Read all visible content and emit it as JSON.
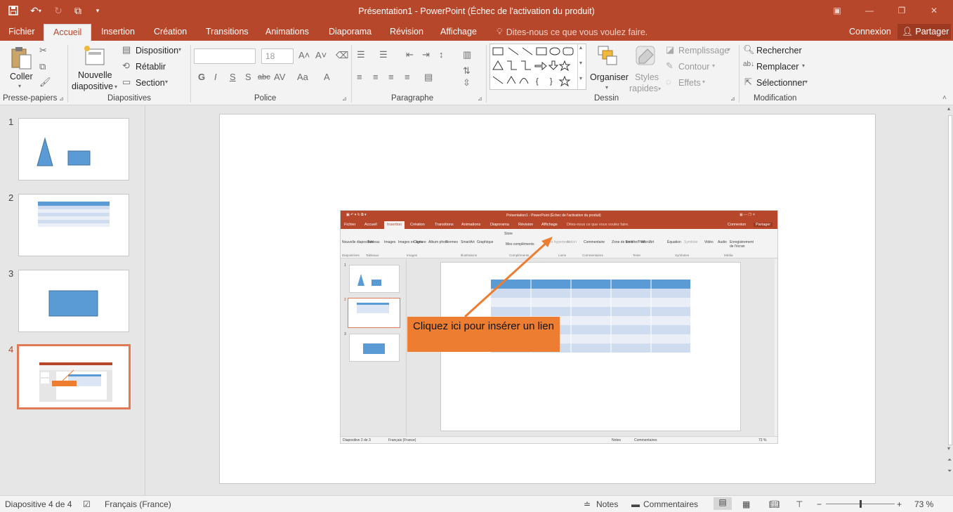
{
  "app": {
    "title": "Présentation1 - PowerPoint (Échec de l'activation du produit)",
    "accent": "#b7472a"
  },
  "quick_access": [
    "save-icon",
    "undo-icon",
    "redo-icon",
    "present-icon",
    "customize-icon"
  ],
  "tabs": [
    {
      "label": "Fichier",
      "active": false
    },
    {
      "label": "Accueil",
      "active": true
    },
    {
      "label": "Insertion",
      "active": false
    },
    {
      "label": "Création",
      "active": false
    },
    {
      "label": "Transitions",
      "active": false
    },
    {
      "label": "Animations",
      "active": false
    },
    {
      "label": "Diaporama",
      "active": false
    },
    {
      "label": "Révision",
      "active": false
    },
    {
      "label": "Affichage",
      "active": false
    }
  ],
  "tell_me": "Dites-nous ce que vous voulez faire.",
  "account": {
    "signin": "Connexion",
    "share": "Partager"
  },
  "ribbon": {
    "clipboard": {
      "paste": "Coller",
      "group": "Presse-papiers"
    },
    "slides": {
      "new_slide_1": "Nouvelle",
      "new_slide_2": "diapositive",
      "layout": "Disposition",
      "reset": "Rétablir",
      "section": "Section",
      "group": "Diapositives"
    },
    "font": {
      "name": "",
      "size": "18",
      "group": "Police"
    },
    "paragraph": {
      "group": "Paragraphe"
    },
    "drawing": {
      "arrange": "Organiser",
      "quick_styles_1": "Styles",
      "quick_styles_2": "rapides",
      "fill": "Remplissage",
      "outline": "Contour",
      "effects": "Effets",
      "group": "Dessin"
    },
    "editing": {
      "find": "Rechercher",
      "replace": "Remplacer",
      "select": "Sélectionner",
      "group": "Modification"
    }
  },
  "thumbnails": [
    {
      "number": "1",
      "selected": false
    },
    {
      "number": "2",
      "selected": false
    },
    {
      "number": "3",
      "selected": false
    },
    {
      "number": "4",
      "selected": true
    }
  ],
  "slide": {
    "callout": "Cliquez ici pour insérer un lien",
    "embedded": {
      "title": "Présentation1 - PowerPoint (Échec de l'activation du produit)",
      "tabs": [
        "Fichier",
        "Accueil",
        "Insertion",
        "Création",
        "Transitions",
        "Animations",
        "Diaporama",
        "Révision",
        "Affichage"
      ],
      "active_tab": "Insertion",
      "tell_me": "Dites-nous ce que vous voulez faire.",
      "signin": "Connexion",
      "share": "Partager",
      "ribbon_items": [
        "Nouvelle diapositive",
        "Tableau",
        "Images",
        "Images en ligne",
        "Capture",
        "Album photo",
        "Formes",
        "SmartArt",
        "Graphique",
        "Store",
        "Mes compléments",
        "Lien hypertexte",
        "Action",
        "Commentaire",
        "Zone de texte",
        "En-tête/Pied",
        "WordArt",
        "Équation",
        "Symbole",
        "Vidéo",
        "Audio",
        "Enregistrement de l'écran"
      ],
      "group_labels": [
        "Diapositives",
        "Tableaux",
        "Images",
        "Illustrations",
        "Compléments",
        "Liens",
        "Commentaires",
        "Texte",
        "Symboles",
        "Média"
      ],
      "thumb_numbers": [
        "1",
        "2",
        "3"
      ],
      "status_left": "Diapositive 2 de 3",
      "status_lang": "Français (France)",
      "status_notes": "Notes",
      "status_comments": "Commentaires",
      "zoom": "73 %"
    }
  },
  "status": {
    "slide_of": "Diapositive 4 de 4",
    "language": "Français (France)",
    "notes": "Notes",
    "comments": "Commentaires",
    "zoom": "73 %",
    "zoom_level": 0.5
  }
}
